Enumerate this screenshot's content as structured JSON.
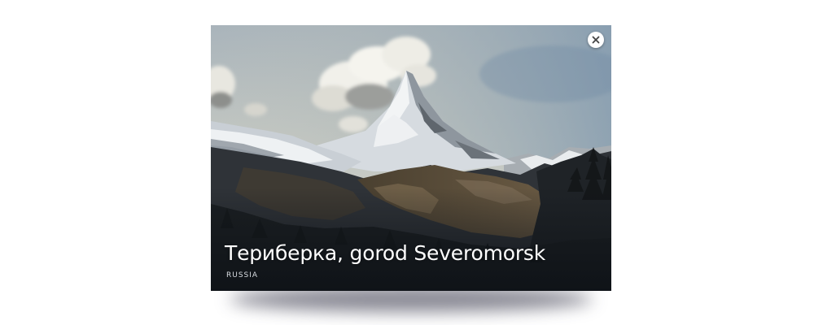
{
  "card": {
    "title": "Териберка, gorod Severomorsk",
    "subtitle": "RUSSIA"
  },
  "image": {
    "subject": "snow-capped mountain peak under cloudy sky"
  },
  "close": {
    "icon": "close-icon"
  },
  "colors": {
    "close_button_bg": "#ffffff",
    "close_glyph": "#444444",
    "title_text": "#ffffff",
    "subtitle_text": "#d9dde2"
  }
}
